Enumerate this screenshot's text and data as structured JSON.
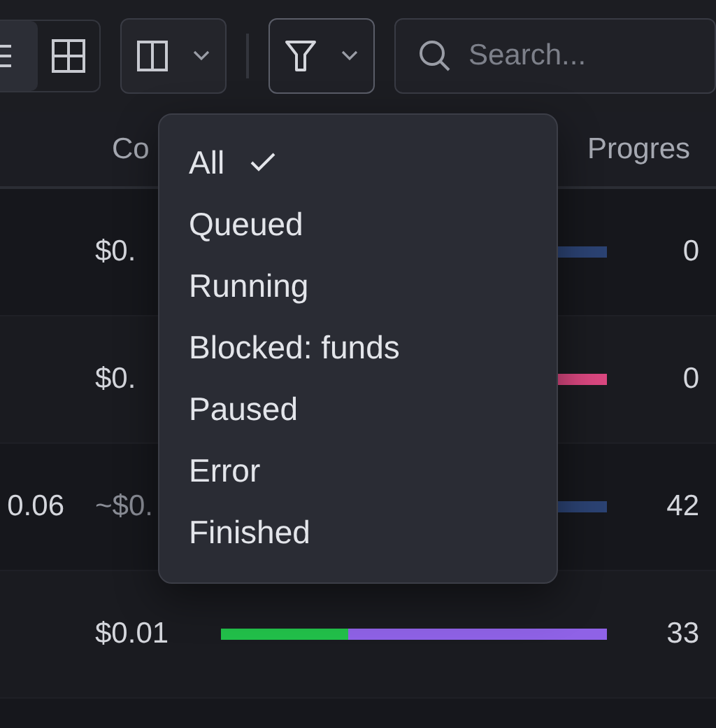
{
  "toolbar": {
    "view_toggle": [
      {
        "kind": "list",
        "selected": true
      },
      {
        "kind": "grid",
        "selected": false
      }
    ],
    "filter_open": true,
    "search": {
      "placeholder": "Search..."
    }
  },
  "table": {
    "columns": [
      "Co",
      "Progres"
    ],
    "rows": [
      {
        "cost": "$0.",
        "estimated": false,
        "bar": [
          {
            "color": "#2b4272"
          }
        ],
        "progress": "0"
      },
      {
        "cost": "$0.",
        "estimated": false,
        "bar": [
          {
            "color": "#d9477f"
          }
        ],
        "progress": "0"
      },
      {
        "column_1": "0.06",
        "cost": "~$0.",
        "estimated": true,
        "bar": [
          {
            "color": "#2b4272"
          }
        ],
        "progress": "42"
      },
      {
        "cost": "$0.01",
        "estimated": false,
        "bar": [
          {
            "color": "#22c04a",
            "level": 0.33
          },
          {
            "color": "#8f62e6",
            "level": 0.67
          }
        ],
        "progress": "33"
      }
    ]
  },
  "filter_menu": {
    "items": [
      {
        "label": "All",
        "selected": true
      },
      {
        "label": "Queued",
        "selected": false
      },
      {
        "label": "Running",
        "selected": false
      },
      {
        "label": "Blocked: funds",
        "selected": false
      },
      {
        "label": "Paused",
        "selected": false
      },
      {
        "label": "Error",
        "selected": false
      },
      {
        "label": "Finished",
        "selected": false
      }
    ]
  }
}
